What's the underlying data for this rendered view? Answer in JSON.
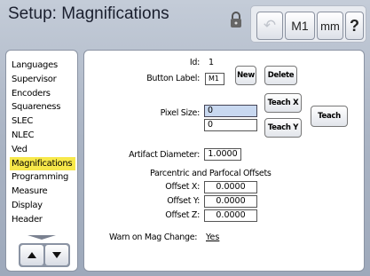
{
  "header": {
    "title": "Setup: Magnifications",
    "toolbar": {
      "undo_label": "↶",
      "m1_label": "M1",
      "units_label": "mm",
      "help_label": "?"
    }
  },
  "sidebar": {
    "items": [
      {
        "label": "Languages"
      },
      {
        "label": "Supervisor"
      },
      {
        "label": "Encoders"
      },
      {
        "label": "Squareness"
      },
      {
        "label": "SLEC"
      },
      {
        "label": "NLEC"
      },
      {
        "label": "Ved"
      },
      {
        "label": "Magnifications"
      },
      {
        "label": "Programming"
      },
      {
        "label": "Measure"
      },
      {
        "label": "Display"
      },
      {
        "label": "Header"
      }
    ],
    "selected": "Magnifications"
  },
  "form": {
    "id_label": "Id:",
    "id_value": "1",
    "button_label_label": "Button Label:",
    "button_label_value": "M1",
    "new_button": "New",
    "delete_button": "Delete",
    "pixel_size_label": "Pixel Size:",
    "pixel_size_x": "0",
    "pixel_size_y": "0",
    "teach_x_button": "Teach X",
    "teach_y_button": "Teach Y",
    "teach_button": "Teach",
    "artifact_diameter_label": "Artifact Diameter:",
    "artifact_diameter_value": "1.0000",
    "offsets_section_title": "Parcentric and Parfocal Offsets",
    "offset_x_label": "Offset X:",
    "offset_x_value": "0.0000",
    "offset_y_label": "Offset Y:",
    "offset_y_value": "0.0000",
    "offset_z_label": "Offset Z:",
    "offset_z_value": "0.0000",
    "warn_label": "Warn on Mag Change:",
    "warn_value": "Yes"
  },
  "colors": {
    "selected_highlight": "#f7e84a",
    "focused_field": "#c8d8f0"
  }
}
